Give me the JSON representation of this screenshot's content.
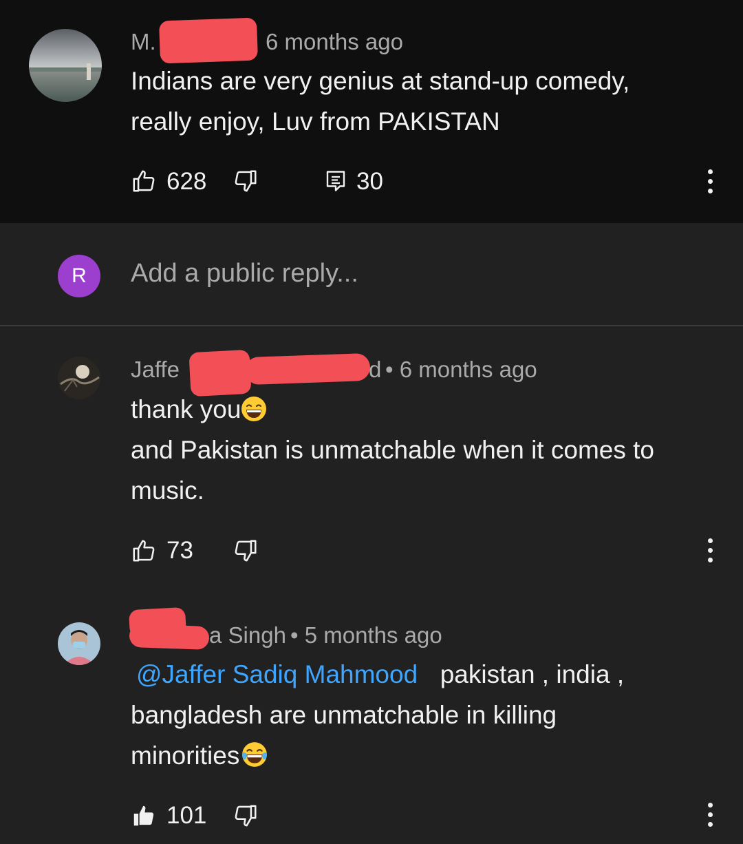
{
  "top_comment": {
    "author_prefix": "M.",
    "time": "6 months ago",
    "text_line1": "Indians are very genius at stand-up comedy,",
    "text_line2": "really enjoy, Luv from PAKISTAN",
    "likes": "628",
    "replies": "30"
  },
  "reply_box": {
    "avatar_letter": "R",
    "placeholder": "Add a public reply..."
  },
  "replies": [
    {
      "author_prefix": "Jaffe",
      "author_suffix": "d",
      "time": "• 6 months ago",
      "text_line1": "thank you",
      "text_line2": "and Pakistan is unmatchable when it comes to",
      "text_line3": "music.",
      "likes": "73"
    },
    {
      "author_suffix": "a Singh",
      "time": "• 5 months ago",
      "mention": "@Jaffer Sadiq Mahmood",
      "text_line1": "pakistan , india ,",
      "text_line2": "bangladesh are unmatchable in killing",
      "text_line3": "minorities",
      "likes": "101"
    }
  ],
  "colors": {
    "accent_link": "#3ea6ff",
    "avatar_r": "#9c3fcf",
    "redaction": "#f24f57"
  },
  "icons": {
    "like": "thumbs-up-icon",
    "dislike": "thumbs-down-icon",
    "reply": "comment-reply-icon",
    "more": "more-vert-icon"
  }
}
